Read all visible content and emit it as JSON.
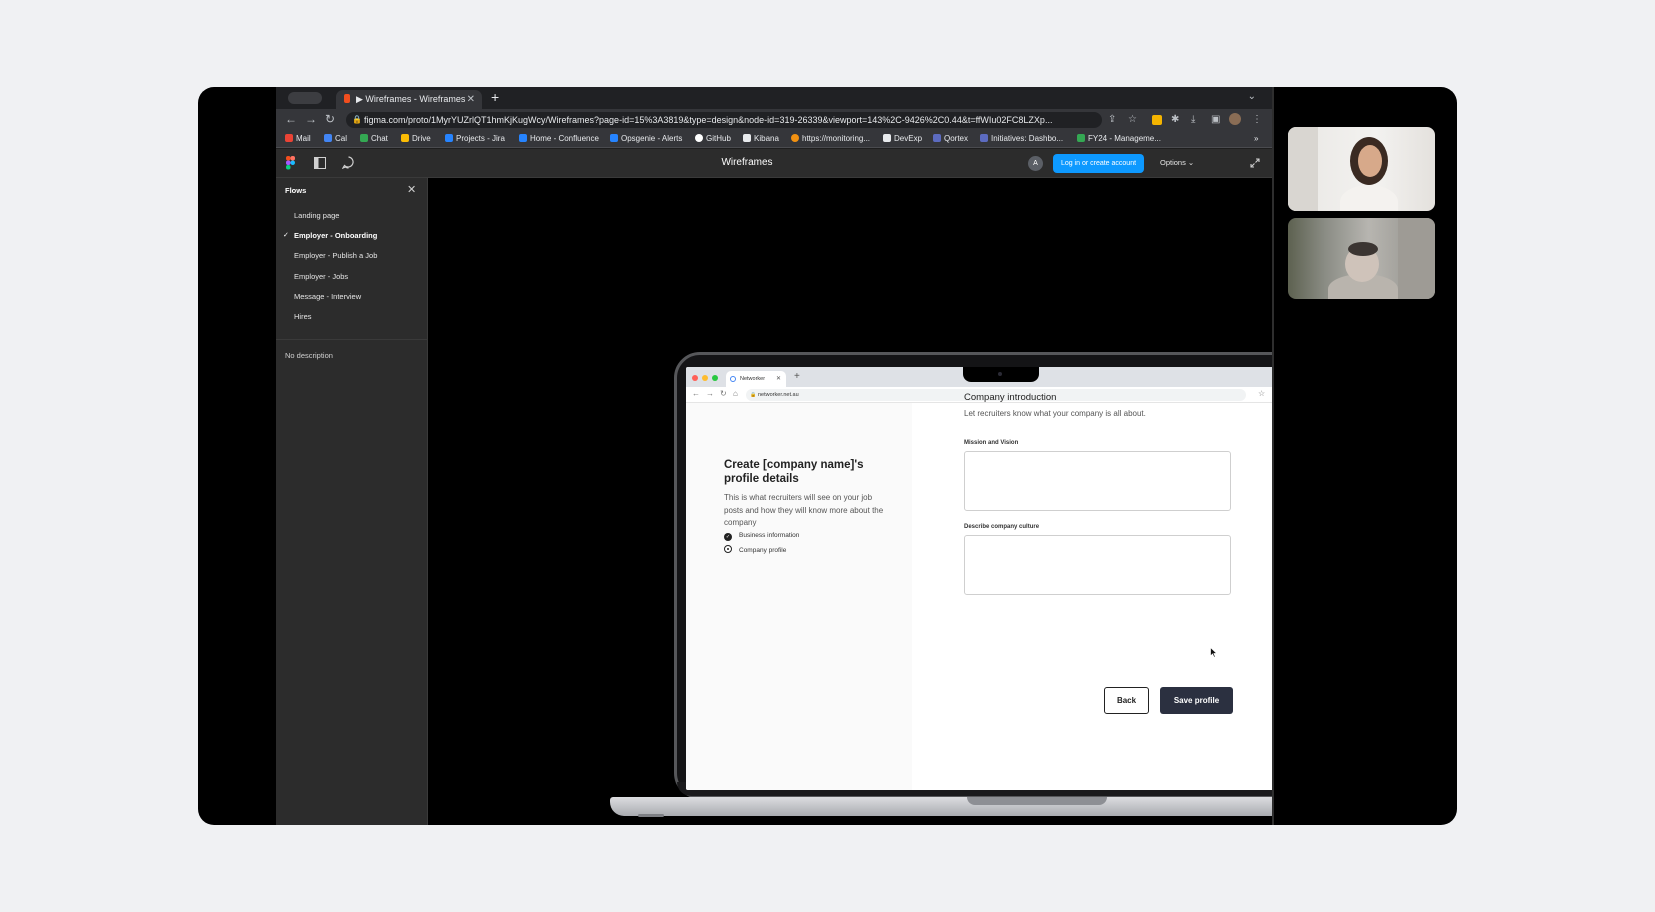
{
  "browser": {
    "tab_title": "▶ Wireframes - Wireframes",
    "tab_close": "✕",
    "new_tab": "+",
    "url": "figma.com/proto/1MyrYUZrlQT1hmKjKugWcy/Wireframes?page-id=15%3A3819&type=design&node-id=319-26339&viewport=143%2C-9426%2C0.44&t=ffWIu02FC8LZXp...",
    "bookmarks": [
      {
        "label": "Mail",
        "color": "#ea4335"
      },
      {
        "label": "Cal",
        "color": "#4285f4"
      },
      {
        "label": "Chat",
        "color": "#34a853"
      },
      {
        "label": "Drive",
        "color": "#fbbc04"
      },
      {
        "label": "Projects - Jira",
        "color": "#2684ff"
      },
      {
        "label": "Home - Confluence",
        "color": "#2684ff"
      },
      {
        "label": "Opsgenie - Alerts",
        "color": "#2684ff"
      },
      {
        "label": "GitHub",
        "color": "#ffffff"
      },
      {
        "label": "Kibana",
        "color": "#e8eaed"
      },
      {
        "label": "https://monitoring...",
        "color": "#f29111"
      },
      {
        "label": "DevExp",
        "color": "#e8eaed"
      },
      {
        "label": "Qortex",
        "color": "#5c6bc0"
      },
      {
        "label": "Initiatives: Dashbo...",
        "color": "#5c6bc0"
      },
      {
        "label": "FY24 - Manageme...",
        "color": "#34a853"
      }
    ],
    "more_bookmarks": "»"
  },
  "figma": {
    "title": "Wireframes",
    "avatar_letter": "A",
    "login_label": "Log in or create account",
    "options_label": "Options ⌄"
  },
  "sidebar": {
    "title": "Flows",
    "close": "✕",
    "flows": [
      {
        "label": "Landing page",
        "active": false
      },
      {
        "label": "Employer - Onboarding",
        "active": true
      },
      {
        "label": "Employer - Publish a Job",
        "active": false
      },
      {
        "label": "Employer - Jobs",
        "active": false
      },
      {
        "label": "Message - Interview",
        "active": false
      },
      {
        "label": "Hires",
        "active": false
      }
    ],
    "check": "✓",
    "description": "No description"
  },
  "prototype": {
    "tab_title": "Networker",
    "tab_close": "✕",
    "new_tab": "+",
    "url": "networker.net.au",
    "heading": "Create [company name]'s profile details",
    "description": "This is what recruiters will see on your job posts and how they will know more about the company",
    "steps": [
      {
        "label": "Business information",
        "status": "done"
      },
      {
        "label": "Company profile",
        "status": "current"
      }
    ],
    "step_check": "✓",
    "section_title": "Company introduction",
    "section_desc": "Let recruiters know what your company is all about.",
    "field_mission_label": "Mission and Vision",
    "field_culture_label": "Describe company culture",
    "back_label": "Back",
    "save_label": "Save profile"
  },
  "colors": {
    "accent": "#0d99ff",
    "primary_button": "#2b3040"
  }
}
